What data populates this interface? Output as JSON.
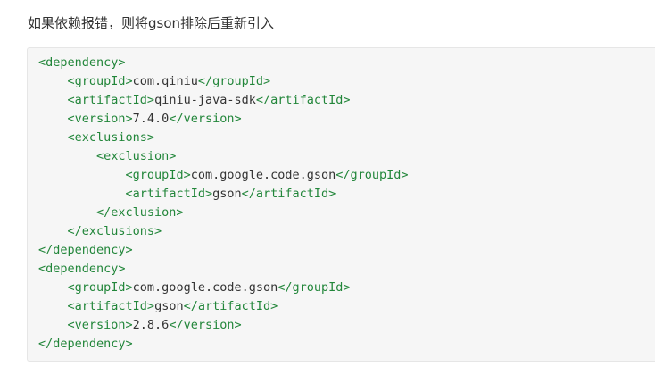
{
  "intro_text": "如果依赖报错，则将gson排除后重新引入",
  "code_lines": [
    {
      "indent": "",
      "open": "<dependency>",
      "text": "",
      "close": ""
    },
    {
      "indent": "    ",
      "open": "<groupId>",
      "text": "com.qiniu",
      "close": "</groupId>"
    },
    {
      "indent": "    ",
      "open": "<artifactId>",
      "text": "qiniu-java-sdk",
      "close": "</artifactId>"
    },
    {
      "indent": "    ",
      "open": "<version>",
      "text": "7.4.0",
      "close": "</version>"
    },
    {
      "indent": "    ",
      "open": "<exclusions>",
      "text": "",
      "close": ""
    },
    {
      "indent": "        ",
      "open": "<exclusion>",
      "text": "",
      "close": ""
    },
    {
      "indent": "            ",
      "open": "<groupId>",
      "text": "com.google.code.gson",
      "close": "</groupId>"
    },
    {
      "indent": "            ",
      "open": "<artifactId>",
      "text": "gson",
      "close": "</artifactId>"
    },
    {
      "indent": "        ",
      "open": "</exclusion>",
      "text": "",
      "close": ""
    },
    {
      "indent": "    ",
      "open": "</exclusions>",
      "text": "",
      "close": ""
    },
    {
      "indent": "",
      "open": "</dependency>",
      "text": "",
      "close": ""
    },
    {
      "indent": "",
      "open": "<dependency>",
      "text": "",
      "close": ""
    },
    {
      "indent": "    ",
      "open": "<groupId>",
      "text": "com.google.code.gson",
      "close": "</groupId>"
    },
    {
      "indent": "    ",
      "open": "<artifactId>",
      "text": "gson",
      "close": "</artifactId>"
    },
    {
      "indent": "    ",
      "open": "<version>",
      "text": "2.8.6",
      "close": "</version>"
    },
    {
      "indent": "",
      "open": "</dependency>",
      "text": "",
      "close": ""
    }
  ],
  "colors": {
    "tag": "#22863a",
    "text": "#333333",
    "code_background": "#f6f6f6"
  }
}
